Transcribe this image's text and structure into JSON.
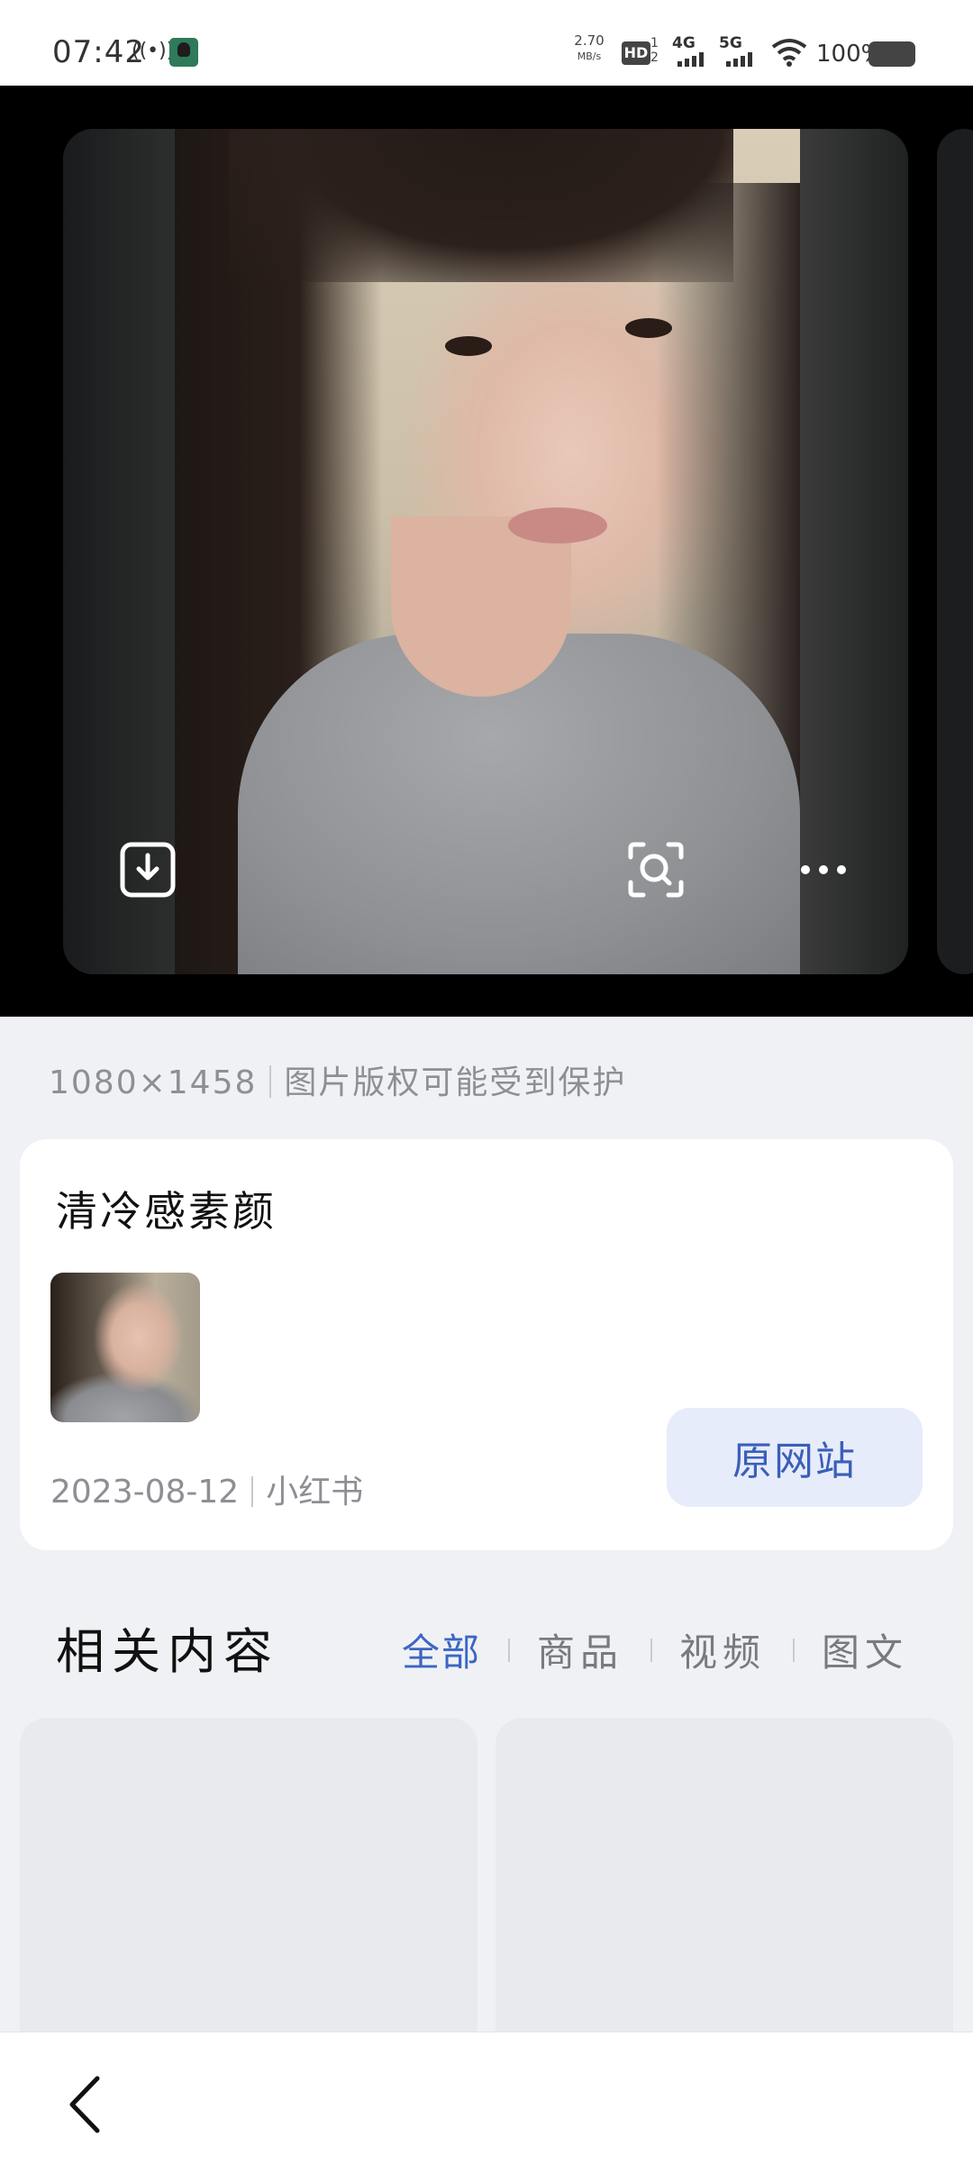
{
  "status_bar": {
    "time": "07:42",
    "hotspot_icon": "wireless-broadcast-icon",
    "net_speed_value": "2.70",
    "net_speed_unit": "MB/s",
    "hd_label": "HD",
    "hd_sub": "1\n2",
    "network_1": "4G",
    "network_2": "5G",
    "battery_percent": "100%"
  },
  "viewer": {
    "download_icon": "download-icon",
    "lens_icon": "visual-search-icon",
    "more_icon": "more-icon"
  },
  "image_info": {
    "dimensions": "1080×1458",
    "copyright": "图片版权可能受到保护"
  },
  "source": {
    "title": "清冷感素颜",
    "date": "2023-08-12",
    "site": "小红书",
    "button_label": "原网站"
  },
  "related": {
    "title": "相关内容",
    "tabs": [
      {
        "label": "全部",
        "active": true
      },
      {
        "label": "商品",
        "active": false
      },
      {
        "label": "视频",
        "active": false
      },
      {
        "label": "图文",
        "active": false
      }
    ]
  },
  "colors": {
    "accent": "#3b66c4",
    "button_bg": "#e7ecfb",
    "page_bg": "#f0f1f4",
    "viewer_bg": "#000000"
  }
}
